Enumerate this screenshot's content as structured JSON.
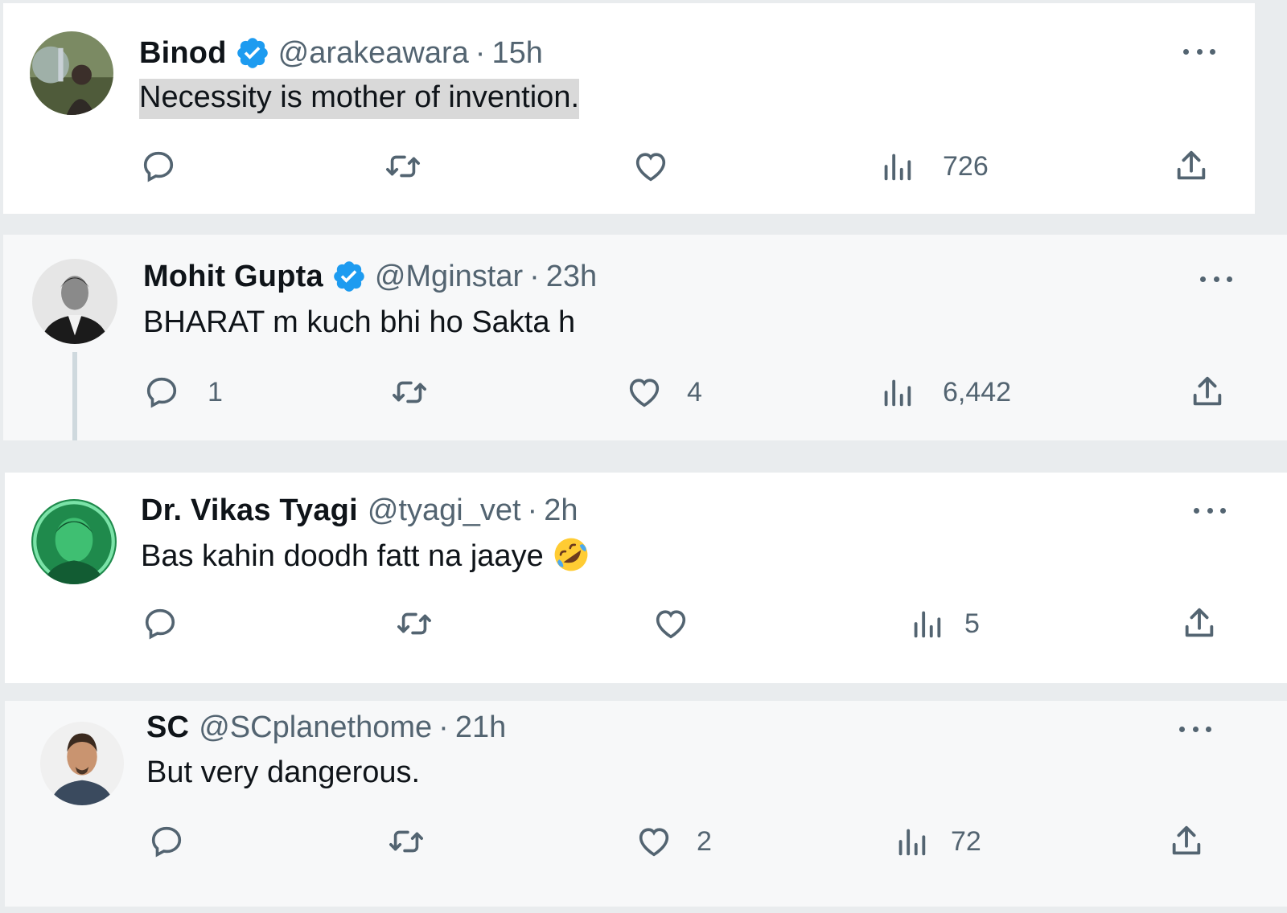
{
  "tweets": [
    {
      "name": "Binod",
      "verified": true,
      "handle": "@arakeawara",
      "separator": "·",
      "time": "15h",
      "text": "Necessity is mother of invention.",
      "replies": "",
      "likes": "",
      "views": "726"
    },
    {
      "name": "Mohit Gupta",
      "verified": true,
      "handle": "@Mginstar",
      "separator": "·",
      "time": "23h",
      "text": "BHARAT m kuch bhi ho Sakta h",
      "replies": "1",
      "likes": "4",
      "views": "6,442"
    },
    {
      "name": "Dr. Vikas Tyagi",
      "verified": false,
      "handle": "@tyagi_vet",
      "separator": "·",
      "time": "2h",
      "text": "Bas kahin doodh fatt na jaaye",
      "emoji": "rolling-on-floor-laughing",
      "replies": "",
      "likes": "",
      "views": "5"
    },
    {
      "name": "SC",
      "verified": false,
      "handle": "@SCplanethome",
      "separator": "·",
      "time": "21h",
      "text": "But very dangerous.",
      "replies": "",
      "likes": "2",
      "views": "72"
    }
  ],
  "icons": {
    "reply": "speech-bubble-icon",
    "retweet": "retweet-icon",
    "like": "heart-icon",
    "views": "bar-chart-icon",
    "share": "upload-icon",
    "more": "ellipsis-icon",
    "verified": "verified-badge-icon"
  },
  "colors": {
    "text": "#0f1419",
    "secondary": "#536471",
    "verified": "#1d9bf0",
    "background": "#ffffff",
    "highlight": "#d9d9d9"
  }
}
